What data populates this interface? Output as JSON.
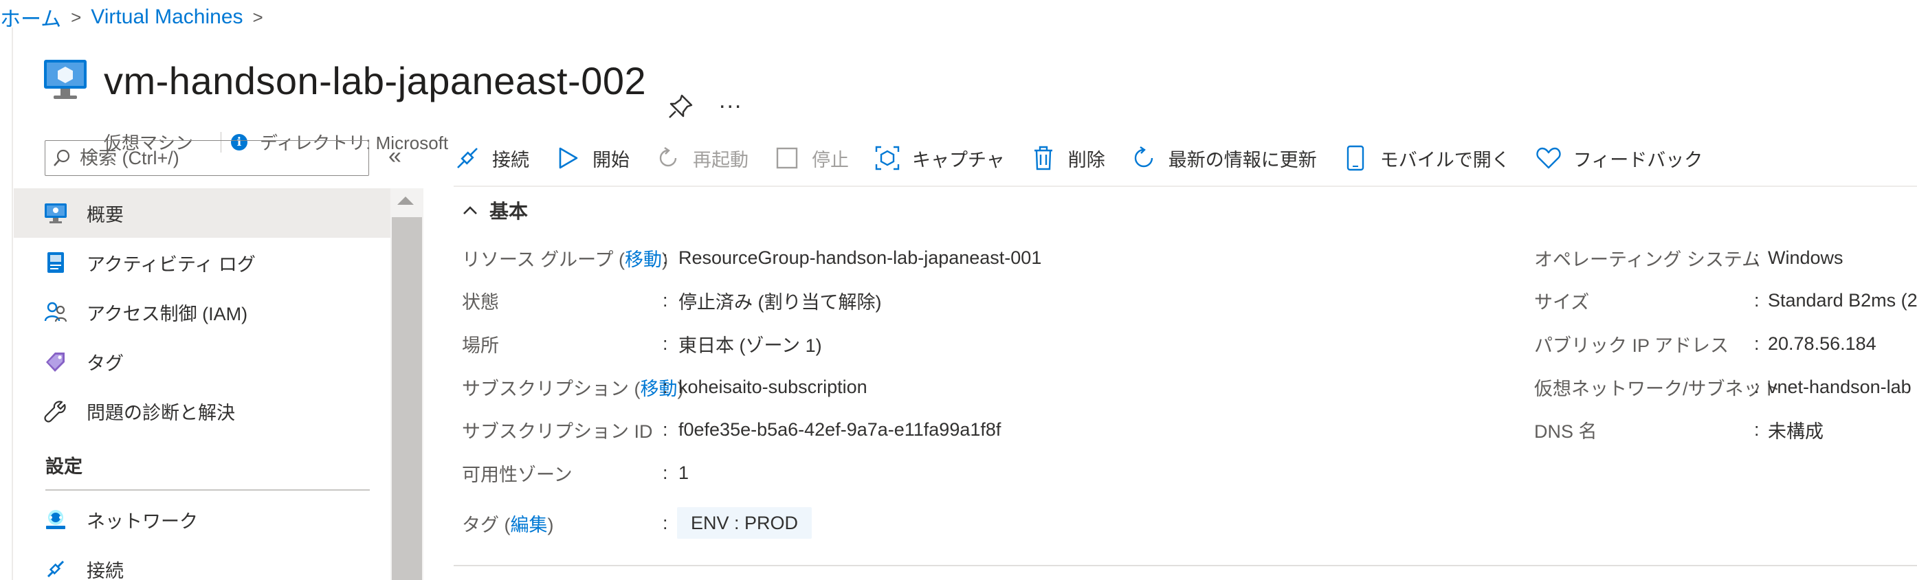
{
  "breadcrumb": {
    "home": "ホーム",
    "parent": "Virtual Machines"
  },
  "header": {
    "title": "vm-handson-lab-japaneast-002",
    "subtitle_type": "仮想マシン",
    "subtitle_directory": "ディレクトリ: Microsoft",
    "more": "..."
  },
  "search": {
    "placeholder": "検索 (Ctrl+/)"
  },
  "sidebar": {
    "collapse": "«",
    "items": [
      {
        "label": "概要",
        "icon": "vm-overview-icon"
      },
      {
        "label": "アクティビティ ログ",
        "icon": "activity-log-icon"
      },
      {
        "label": "アクセス制御 (IAM)",
        "icon": "iam-icon"
      },
      {
        "label": "タグ",
        "icon": "tag-icon"
      },
      {
        "label": "問題の診断と解決",
        "icon": "wrench-icon"
      }
    ],
    "section_settings": "設定",
    "settings_items": [
      {
        "label": "ネットワーク",
        "icon": "network-icon"
      },
      {
        "label": "接続",
        "icon": "connect-icon"
      }
    ]
  },
  "toolbar": {
    "connect": "接続",
    "start": "開始",
    "restart": "再起動",
    "stop": "停止",
    "capture": "キャプチャ",
    "delete": "削除",
    "refresh": "最新の情報に更新",
    "mobile": "モバイルで開く",
    "feedback": "フィードバック"
  },
  "essentials": {
    "heading": "基本",
    "left": {
      "resource_group_label": "リソース グループ",
      "move_label": "移動",
      "resource_group_value": "ResourceGroup-handson-lab-japaneast-001",
      "status_label": "状態",
      "status_value": "停止済み (割り当て解除)",
      "location_label": "場所",
      "location_value": "東日本 (ゾーン 1)",
      "subscription_label": "サブスクリプション",
      "subscription_value": "koheisaito-subscription",
      "subscription_id_label": "サブスクリプション ID",
      "subscription_id_value": "f0efe35e-b5a6-42ef-9a7a-e11fa99a1f8f",
      "zone_label": "可用性ゾーン",
      "zone_value": "1",
      "tags_label": "タグ",
      "edit_label": "編集",
      "tag_value": "ENV : PROD"
    },
    "right": {
      "os_label": "オペレーティング システム",
      "os_value": "Windows",
      "size_label": "サイズ",
      "size_value": "Standard B2ms (2",
      "public_ip_label": "パブリック IP アドレス",
      "public_ip_value": "20.78.56.184",
      "vnet_label": "仮想ネットワーク/サブネット",
      "vnet_value": "vnet-handson-lab",
      "dns_label": "DNS 名",
      "dns_value": "未構成"
    }
  },
  "colors": {
    "accent": "#0078d4",
    "text": "#323130",
    "muted": "#605e5c",
    "selected": "#edebe9"
  }
}
